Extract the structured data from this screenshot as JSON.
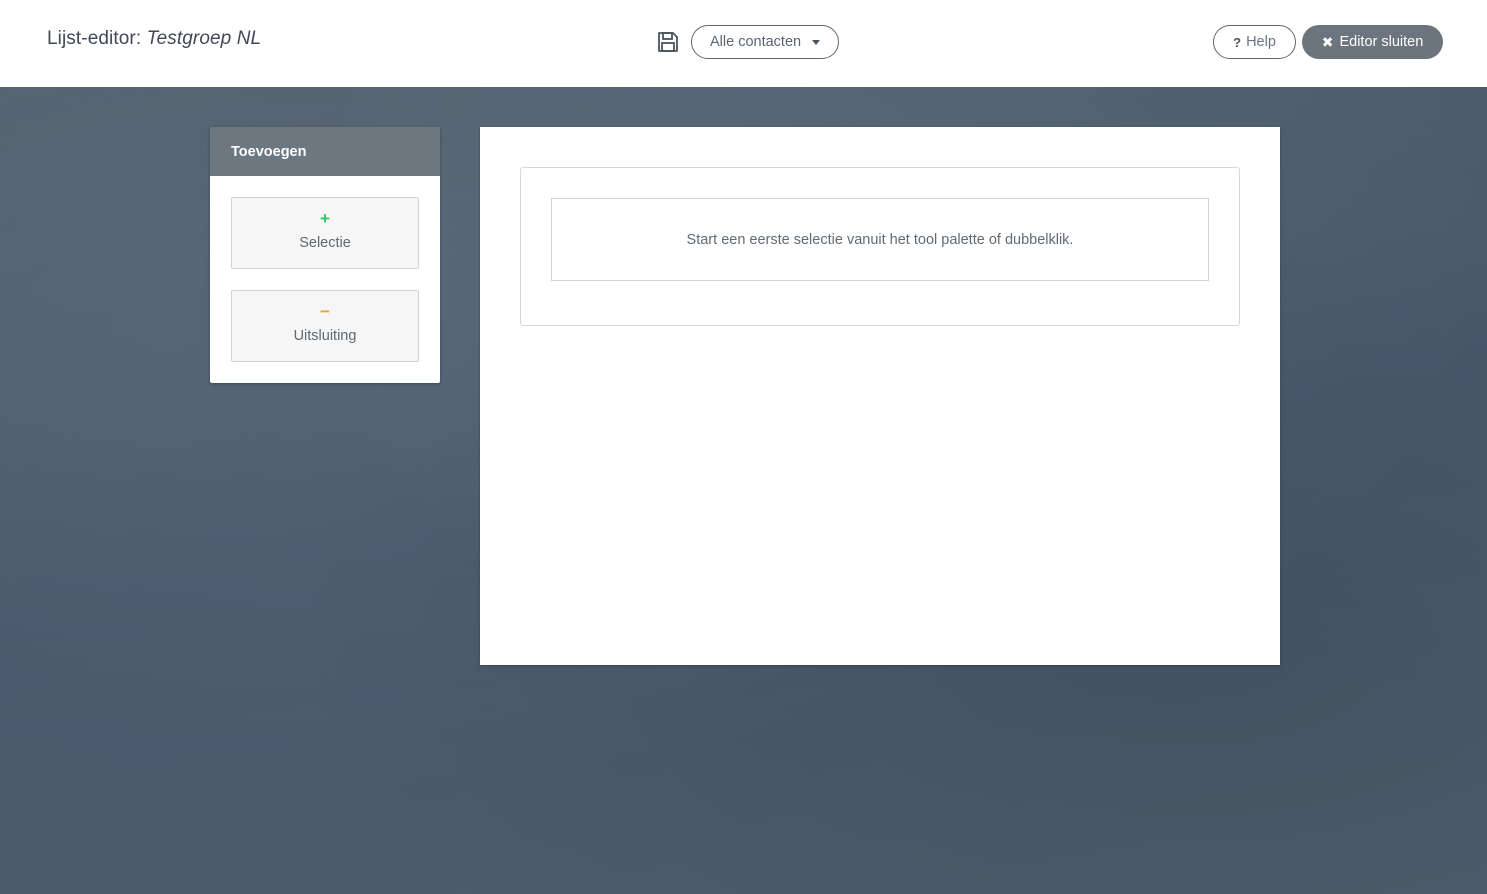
{
  "header": {
    "title_prefix": "Lijst-editor:",
    "list_name": "Testgroep NL",
    "save_icon": "floppy-disk-icon",
    "contacts_filter": "Alle contacten",
    "help_label": "Help",
    "close_label": "Editor sluiten"
  },
  "palette": {
    "title": "Toevoegen",
    "tools": [
      {
        "symbol": "+",
        "label": "Selectie",
        "color": "#2fc86a"
      },
      {
        "symbol": "−",
        "label": "Uitsluiting",
        "color": "#f2a21b"
      }
    ]
  },
  "canvas": {
    "empty_message": "Start een eerste selectie vanuit het tool palette of dubbelklik."
  }
}
